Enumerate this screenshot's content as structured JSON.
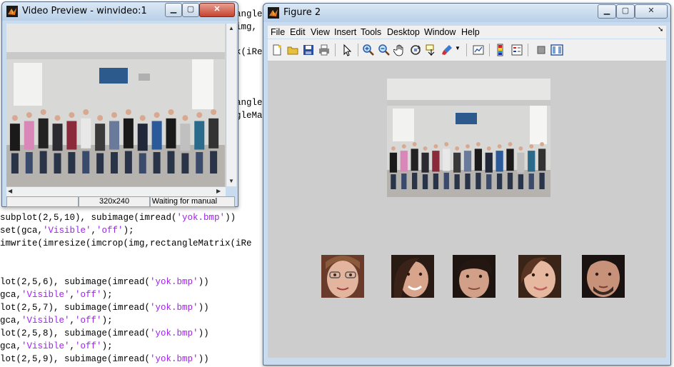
{
  "editor": {
    "lines": [
      {
        "pre": "subplot(2,5,10), subimage(imread(",
        "str": "'yok.bmp'",
        "post": "))"
      },
      {
        "pre": "set(gca,",
        "str": "'Visible'",
        "post": ",",
        "str2": "'off'",
        "post2": ");"
      },
      {
        "pre": "imwrite(imresize(imcrop(img,rectangleMatrix(iRe",
        "str": "",
        "post": ""
      },
      {
        "pre": "lot(2,5,6), subimage(imread(",
        "str": "'yok.bmp'",
        "post": "))"
      },
      {
        "pre": "gca,",
        "str": "'Visible'",
        "post": ",",
        "str2": "'off'",
        "post2": ");"
      },
      {
        "pre": "lot(2,5,7), subimage(imread(",
        "str": "'yok.bmp'",
        "post": "))"
      },
      {
        "pre": "gca,",
        "str": "'Visible'",
        "post": ",",
        "str2": "'off'",
        "post2": ");"
      },
      {
        "pre": "lot(2,5,8), subimage(imread(",
        "str": "'yok.bmp'",
        "post": "))"
      },
      {
        "pre": "gca,",
        "str": "'Visible'",
        "post": ",",
        "str2": "'off'",
        "post2": ");"
      },
      {
        "pre": "lot(2,5,9), subimage(imread(",
        "str": "'yok.bmp'",
        "post": "))"
      }
    ],
    "fragments": [
      "angle",
      "img,",
      "k(iRe",
      "angle",
      "gleMa"
    ]
  },
  "video_preview": {
    "title": "Video Preview - winvideo:1",
    "status_left": "",
    "status_resolution": "320x240",
    "status_right": "Waiting for manual"
  },
  "figure": {
    "title": "Figure 2",
    "menus": [
      "File",
      "Edit",
      "View",
      "Insert",
      "Tools",
      "Desktop",
      "Window",
      "Help"
    ],
    "toolbar_icons": [
      "new-file-icon",
      "open-folder-icon",
      "save-icon",
      "print-icon",
      "pointer-icon",
      "zoom-in-icon",
      "zoom-out-icon",
      "pan-icon",
      "rotate-3d-icon",
      "data-cursor-icon",
      "brush-icon",
      "link-plot-icon",
      "colorbar-icon",
      "legend-icon",
      "hide-plot-tools-icon",
      "show-plot-tools-icon"
    ],
    "face_count": 5
  },
  "colors": {
    "titlebar": "#c9dbee",
    "figure_bg": "#cdcdcd",
    "string_color": "#a020f0",
    "close_button": "#c5432e"
  }
}
